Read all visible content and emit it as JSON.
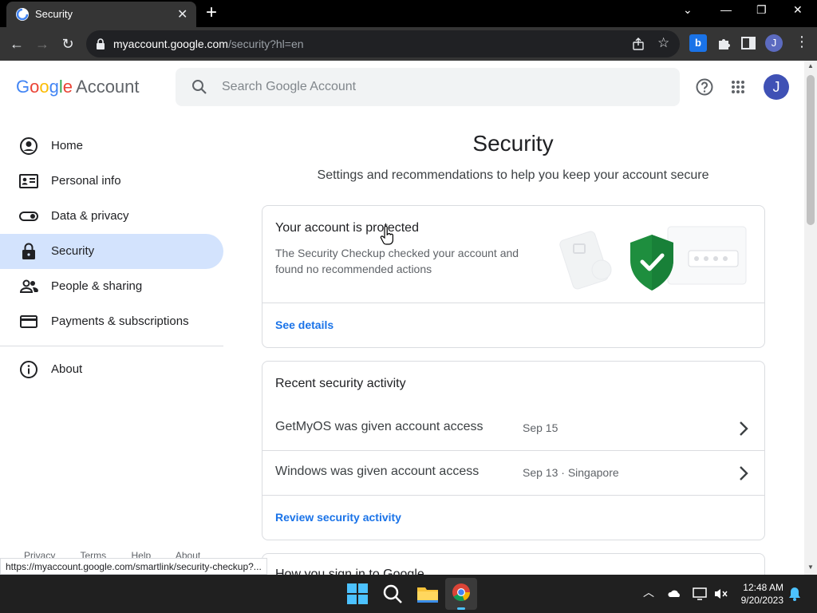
{
  "browser": {
    "tab_title": "Security",
    "url_host": "myaccount.google.com",
    "url_path": "/security?hl=en",
    "profile_initial": "J"
  },
  "header": {
    "brand_account": "Account",
    "search_placeholder": "Search Google Account",
    "avatar_initial": "J"
  },
  "sidebar": {
    "items": [
      {
        "label": "Home"
      },
      {
        "label": "Personal info"
      },
      {
        "label": "Data & privacy"
      },
      {
        "label": "Security"
      },
      {
        "label": "People & sharing"
      },
      {
        "label": "Payments & subscriptions"
      },
      {
        "label": "About"
      }
    ],
    "active_index": 3
  },
  "main": {
    "title": "Security",
    "subtitle": "Settings and recommendations to help you keep your account secure",
    "protected_card": {
      "title": "Your account is protected",
      "text": "The Security Checkup checked your account and found no recommended actions",
      "link": "See details"
    },
    "activity_card": {
      "title": "Recent security activity",
      "rows": [
        {
          "name": "GetMyOS was given account access",
          "date": "Sep 15"
        },
        {
          "name": "Windows was given account access",
          "date": "Sep 13 · Singapore"
        }
      ],
      "link": "Review security activity"
    },
    "next_card_title": "How you sign in to Google"
  },
  "footer": {
    "links": [
      "Privacy",
      "Terms",
      "Help",
      "About"
    ]
  },
  "status_url": "https://myaccount.google.com/smartlink/security-checkup?...",
  "taskbar": {
    "time": "12:48 AM",
    "date": "9/20/2023"
  },
  "colors": {
    "accent": "#1a73e8",
    "active_nav": "#d3e3fd",
    "shield": "#1e8e3e"
  }
}
